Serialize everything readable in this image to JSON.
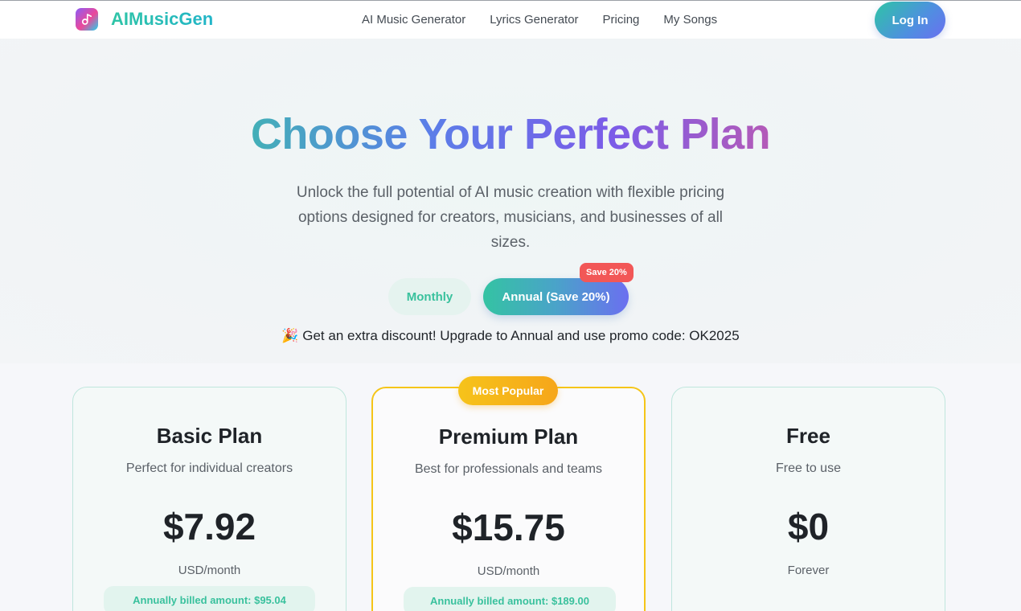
{
  "header": {
    "brand": "AIMusicGen",
    "nav": [
      "AI Music Generator",
      "Lyrics Generator",
      "Pricing",
      "My Songs"
    ],
    "login_label": "Log In"
  },
  "hero": {
    "title": "Choose Your Perfect Plan",
    "subtitle": "Unlock the full potential of AI music creation with flexible pricing options designed for creators, musicians, and businesses of all sizes.",
    "toggle": {
      "monthly_label": "Monthly",
      "annual_label": "Annual (Save 20%)",
      "badge": "Save 20%",
      "selected": "Annual (Save 20%)"
    },
    "promo": "🎉 Get an extra discount! Upgrade to Annual and use promo code: OK2025"
  },
  "plans": [
    {
      "name": "Basic Plan",
      "description": "Perfect for individual creators",
      "price": "$7.92",
      "unit": "USD/month",
      "billed": "Annually billed amount: $95.04"
    },
    {
      "name": "Premium Plan",
      "description": "Best for professionals and teams",
      "price": "$15.75",
      "unit": "USD/month",
      "billed": "Annually billed amount: $189.00",
      "badge": "Most Popular"
    },
    {
      "name": "Free",
      "description": "Free to use",
      "price": "$0",
      "unit": "Forever"
    }
  ],
  "colors": {
    "accent_teal": "#2ec4a6",
    "accent_purple": "#6b6ff0",
    "popular_gold": "#f5c518",
    "save_red": "#f25757"
  },
  "icons": {
    "brand": "music-note-icon"
  }
}
